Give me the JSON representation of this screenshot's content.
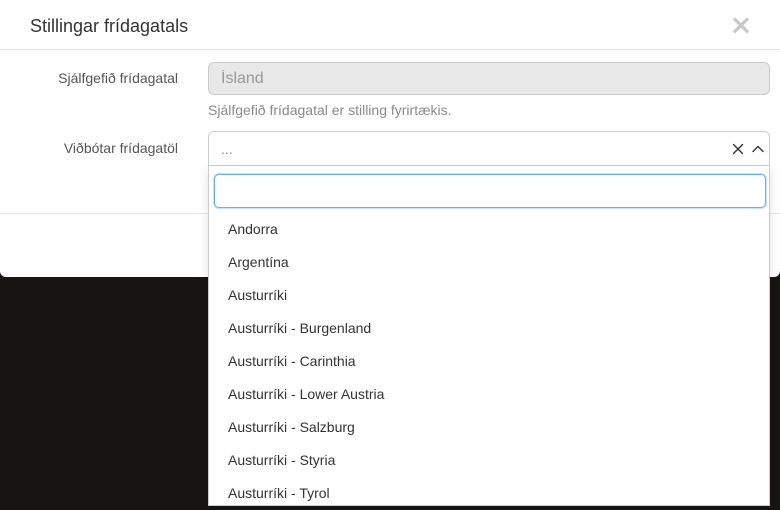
{
  "modal": {
    "title": "Stillingar frídagatals",
    "close_glyph": "×"
  },
  "form": {
    "default_calendar_label": "Sjálfgefið frídagatal",
    "default_calendar_value": "Ísland",
    "default_calendar_help": "Sjálfgefið frídagatal er stilling fyrirtækis.",
    "additional_calendars_label": "Viðbótar frídagatöl",
    "additional_calendars_placeholder": "..."
  },
  "dropdown": {
    "search_value": "",
    "options": [
      "Andorra",
      "Argentína",
      "Austurríki",
      "Austurríki - Burgenland",
      "Austurríki - Carinthia",
      "Austurríki - Lower Austria",
      "Austurríki - Salzburg",
      "Austurríki - Styria",
      "Austurríki - Tyrol"
    ]
  },
  "icons": {
    "clear": "clear-icon",
    "chevron": "chevron-up-icon",
    "close": "close-icon"
  },
  "colors": {
    "backdrop": "#161511",
    "focus": "#66afe9"
  }
}
